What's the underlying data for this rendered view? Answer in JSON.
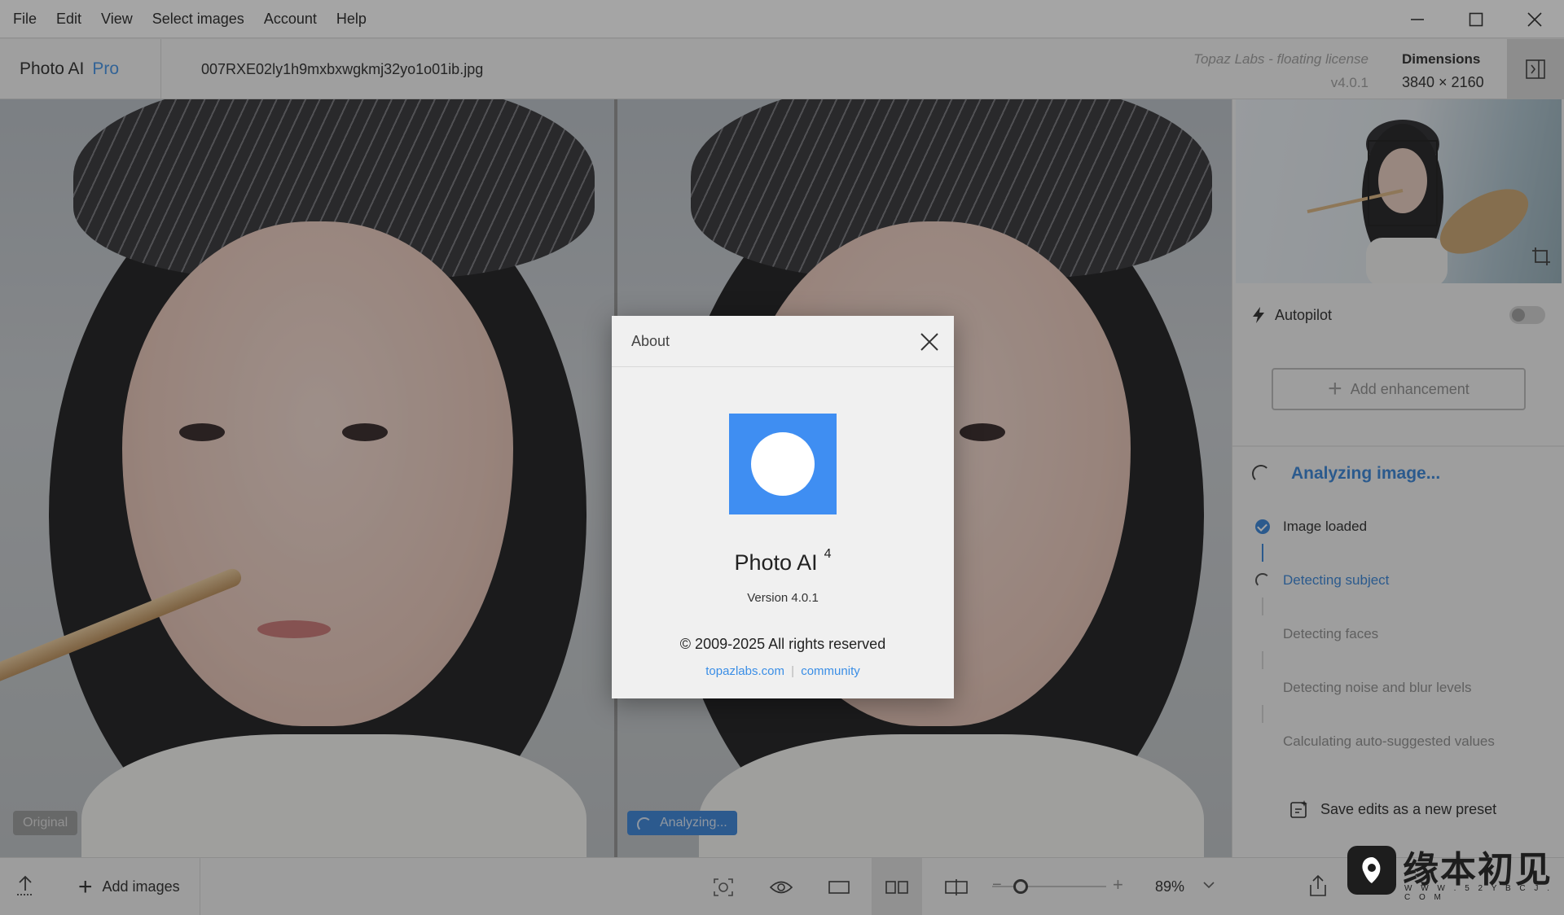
{
  "menu": {
    "items": [
      "File",
      "Edit",
      "View",
      "Select images",
      "Account",
      "Help"
    ]
  },
  "window_controls": [
    "minimize-icon",
    "maximize-icon",
    "close-icon"
  ],
  "header": {
    "app_name": "Photo AI",
    "edition": "Pro",
    "filename": "007RXE02ly1h9mxbxwgkmj32yo1o01ib.jpg",
    "license": "Topaz Labs - floating license",
    "app_version": "v4.0.1",
    "dimensions_label": "Dimensions",
    "dimensions_value": "3840 × 2160"
  },
  "viewer": {
    "left_label": "Original",
    "right_label": "Analyzing..."
  },
  "right_panel": {
    "autopilot_label": "Autopilot",
    "autopilot_on": false,
    "add_enhancement_label": "Add enhancement",
    "analyzing_title": "Analyzing image...",
    "steps": [
      {
        "label": "Image loaded",
        "state": "done"
      },
      {
        "label": "Detecting subject",
        "state": "active"
      },
      {
        "label": "Detecting faces",
        "state": "pending"
      },
      {
        "label": "Detecting noise and blur levels",
        "state": "pending"
      },
      {
        "label": "Calculating auto-suggested values",
        "state": "pending"
      }
    ],
    "save_preset_label": "Save edits as a new preset"
  },
  "toolbar": {
    "add_images_label": "Add images",
    "zoom": "89%"
  },
  "dialog": {
    "title": "About",
    "product": "Photo AI",
    "product_major": "4",
    "version": "Version 4.0.1",
    "copyright": "© 2009-2025 All rights reserved",
    "link_site": "topazlabs.com",
    "link_separator": "|",
    "link_community": "community"
  },
  "watermark": {
    "text": "缘本初见",
    "sub": "W W W . 5 2 Y B C J . C O M"
  },
  "colors": {
    "accent": "#3a8ee6",
    "logo_blue": "#3f8ef2",
    "analyzing_blue": "#2e7fd6"
  }
}
